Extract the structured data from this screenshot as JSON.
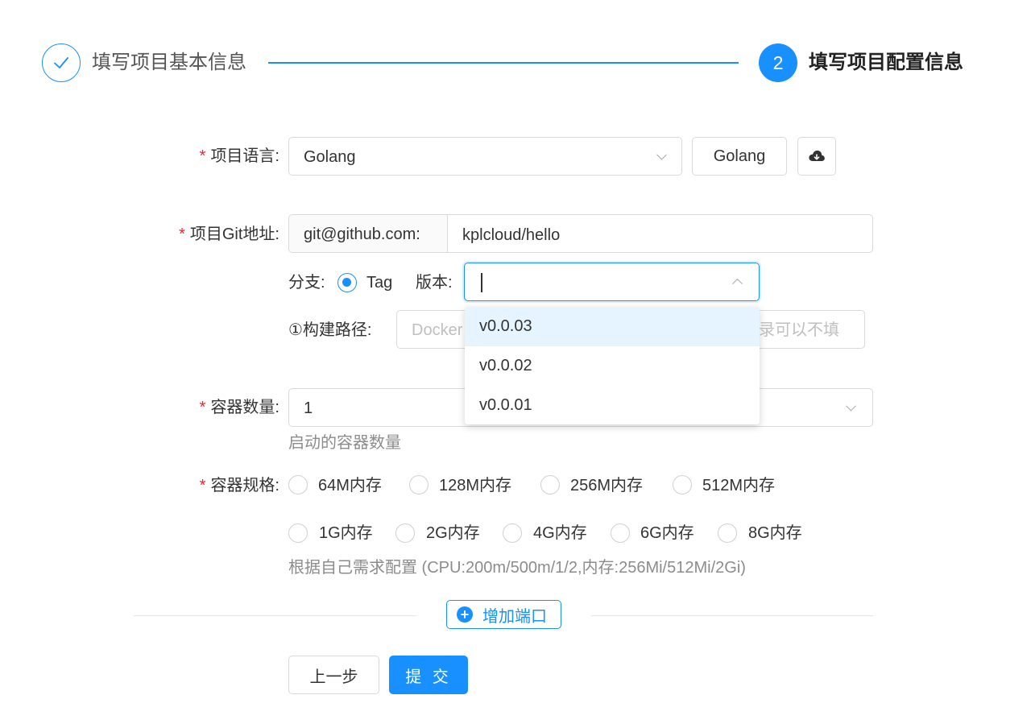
{
  "steps": [
    {
      "title": "填写项目基本信息",
      "status": "finished"
    },
    {
      "number": "2",
      "title": "填写项目配置信息",
      "status": "current"
    }
  ],
  "language": {
    "label": "项目语言:",
    "value": "Golang",
    "button_label": "Golang"
  },
  "git": {
    "label": "项目Git地址:",
    "prefix": "git@github.com:",
    "value": "kplcloud/hello"
  },
  "branch": {
    "label": "分支:",
    "radio_label": "Tag",
    "version_label": "版本:",
    "version_value": ""
  },
  "build_path": {
    "label": "①构建路径:",
    "placeholder_left": "Docker",
    "placeholder_right": "录可以不填"
  },
  "version_options": [
    "v0.0.03",
    "v0.0.02",
    "v0.0.01"
  ],
  "replicas": {
    "label": "容器数量:",
    "value": "1",
    "hint": "启动的容器数量"
  },
  "spec": {
    "label": "容器规格:",
    "options_row1": [
      "64M内存",
      "128M内存",
      "256M内存",
      "512M内存"
    ],
    "options_row2": [
      "1G内存",
      "2G内存",
      "4G内存",
      "6G内存",
      "8G内存"
    ],
    "hint": "根据自己需求配置 (CPU:200m/500m/1/2,内存:256Mi/512Mi/2Gi)"
  },
  "add_port_label": "增加端口",
  "prev_label": "上一步",
  "submit_label": "提 交",
  "colors": {
    "primary": "#1890ff",
    "required": "#f5222d",
    "hint": "#8c8c8c",
    "dropdown_active": "#e6f4ff"
  }
}
